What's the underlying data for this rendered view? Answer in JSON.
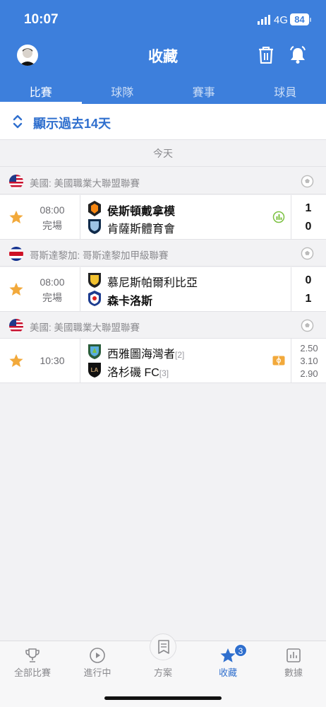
{
  "status": {
    "time": "10:07",
    "network": "4G",
    "battery": "84"
  },
  "header": {
    "title": "收藏"
  },
  "tabs": [
    {
      "label": "比賽",
      "active": true
    },
    {
      "label": "球隊",
      "active": false
    },
    {
      "label": "賽事",
      "active": false
    },
    {
      "label": "球員",
      "active": false
    }
  ],
  "show_past": "顯示過去14天",
  "today_label": "今天",
  "leagues": [
    {
      "country": "美國: 美國職業大聯盟聯賽"
    },
    {
      "country": "哥斯達黎加: 哥斯達黎加甲級聯賽"
    },
    {
      "country": "美國: 美國職業大聯盟聯賽"
    }
  ],
  "matches": [
    {
      "time": "08:00",
      "status": "完場",
      "home": "侯斯頓戴拿模",
      "away": "肯薩斯體育會",
      "home_score": "1",
      "away_score": "0",
      "home_bold": true,
      "away_bold": false
    },
    {
      "time": "08:00",
      "status": "完場",
      "home": "慕尼斯帕爾利比亞",
      "away": "森卡洛斯",
      "home_score": "0",
      "away_score": "1",
      "home_bold": false,
      "away_bold": true
    },
    {
      "time": "10:30",
      "status": "",
      "home": "西雅圖海灣者",
      "home_rank": "[2]",
      "away": "洛杉磯 FC",
      "away_rank": "[3]",
      "odds": [
        "2.50",
        "3.10",
        "2.90"
      ]
    }
  ],
  "bottom_nav": [
    {
      "label": "全部比賽",
      "icon": "trophy-icon",
      "active": false
    },
    {
      "label": "進行中",
      "icon": "play-icon",
      "active": false
    },
    {
      "label": "方案",
      "icon": "plan-icon",
      "active": false
    },
    {
      "label": "收藏",
      "icon": "star-icon",
      "active": true,
      "badge": "3"
    },
    {
      "label": "數據",
      "icon": "stats-icon",
      "active": false
    }
  ],
  "colors": {
    "primary": "#3d7fdc",
    "accent": "#2f6fce",
    "star": "#f2a93b"
  }
}
